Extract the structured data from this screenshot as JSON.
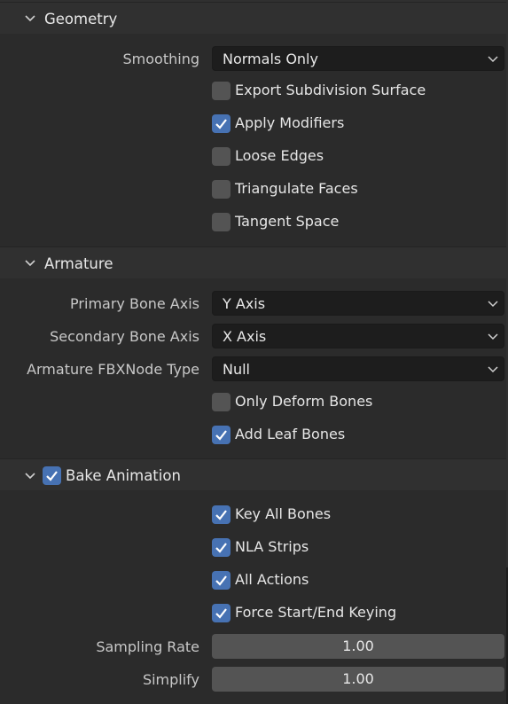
{
  "geometry": {
    "title": "Geometry",
    "smoothing_label": "Smoothing",
    "smoothing_value": "Normals Only",
    "options": [
      {
        "label": "Export Subdivision Surface",
        "checked": false
      },
      {
        "label": "Apply Modifiers",
        "checked": true
      },
      {
        "label": "Loose Edges",
        "checked": false
      },
      {
        "label": "Triangulate Faces",
        "checked": false
      },
      {
        "label": "Tangent Space",
        "checked": false
      }
    ]
  },
  "armature": {
    "title": "Armature",
    "primary_label": "Primary Bone Axis",
    "primary_value": "Y Axis",
    "secondary_label": "Secondary Bone Axis",
    "secondary_value": "X Axis",
    "nodetype_label": "Armature FBXNode Type",
    "nodetype_value": "Null",
    "options": [
      {
        "label": "Only Deform Bones",
        "checked": false
      },
      {
        "label": "Add Leaf Bones",
        "checked": true
      }
    ]
  },
  "bake": {
    "title": "Bake Animation",
    "enabled": true,
    "options": [
      {
        "label": "Key All Bones",
        "checked": true
      },
      {
        "label": "NLA Strips",
        "checked": true
      },
      {
        "label": "All Actions",
        "checked": true
      },
      {
        "label": "Force Start/End Keying",
        "checked": true
      }
    ],
    "sampling_label": "Sampling Rate",
    "sampling_value": "1.00",
    "simplify_label": "Simplify",
    "simplify_value": "1.00"
  },
  "icons": {
    "panel_toggle": "chevron-down-icon",
    "dropdown_arrow": "chevron-down-icon",
    "check": "checkmark-icon"
  },
  "colors": {
    "checkbox_on": "#4772b3",
    "checkbox_off": "#545454",
    "field_bg": "#1d1d1d"
  }
}
